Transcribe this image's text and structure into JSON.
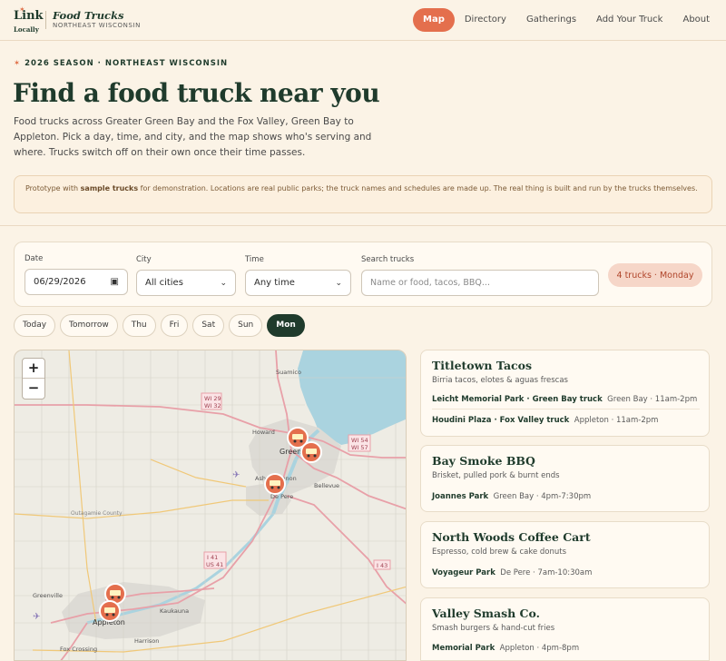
{
  "nav": {
    "logo_mark": "Link",
    "logo_sub": "Locally",
    "brand_title": "Food Trucks",
    "brand_sub": "NORTHEAST WISCONSIN",
    "links": [
      "Map",
      "Directory",
      "Gatherings",
      "Add Your Truck",
      "About"
    ],
    "active_link": "Map"
  },
  "hero": {
    "season": "2026 SEASON · NORTHEAST WISCONSIN",
    "title": "Find a food truck near you",
    "description": "Food trucks across Greater Green Bay and the Fox Valley, Green Bay to Appleton. Pick a day, time, and city, and the map shows who's serving and where. Trucks switch off on their own once their time passes."
  },
  "notice": {
    "prefix": "Prototype with ",
    "bold": "sample trucks",
    "suffix": " for demonstration. Locations are real public parks; the truck names and schedules are made up. The real thing is built and run by the trucks themselves."
  },
  "filters": {
    "date_label": "Date",
    "date_value": "06/29/2026",
    "city_label": "City",
    "city_value": "All cities",
    "time_label": "Time",
    "time_value": "Any time",
    "search_label": "Search trucks",
    "search_placeholder": "Name or food, tacos, BBQ...",
    "count": "4 trucks · Monday"
  },
  "days": [
    "Today",
    "Tomorrow",
    "Thu",
    "Fri",
    "Sat",
    "Sun",
    "Mon"
  ],
  "active_day": "Mon",
  "map": {
    "zoom_in": "+",
    "zoom_out": "−",
    "labels": [
      "Suamico",
      "WI 29",
      "WI 32",
      "Howard",
      "WI 54",
      "WI 57",
      "Green Bay",
      "Ashwaubenon",
      "Bellevue",
      "De Pere",
      "Outagamie County",
      "I 41",
      "US 41",
      "I 43",
      "Greenville",
      "Kaukauna",
      "Appleton",
      "Harrison",
      "Fox Crossing"
    ]
  },
  "trucks": [
    {
      "name": "Titletown Tacos",
      "desc": "Birria tacos, elotes & aguas frescas",
      "stops": [
        {
          "place": "Leicht Memorial Park",
          "tag": "Green Bay truck",
          "city": "Green Bay",
          "time": "11am-2pm"
        },
        {
          "place": "Houdini Plaza",
          "tag": "Fox Valley truck",
          "city": "Appleton",
          "time": "11am-2pm"
        }
      ]
    },
    {
      "name": "Bay Smoke BBQ",
      "desc": "Brisket, pulled pork & burnt ends",
      "stops": [
        {
          "place": "Joannes Park",
          "city": "Green Bay",
          "time": "4pm-7:30pm"
        }
      ]
    },
    {
      "name": "North Woods Coffee Cart",
      "desc": "Espresso, cold brew & cake donuts",
      "stops": [
        {
          "place": "Voyageur Park",
          "city": "De Pere",
          "time": "7am-10:30am"
        }
      ]
    },
    {
      "name": "Valley Smash Co.",
      "desc": "Smash burgers & hand-cut fries",
      "stops": [
        {
          "place": "Memorial Park",
          "city": "Appleton",
          "time": "4pm-8pm"
        }
      ]
    }
  ]
}
